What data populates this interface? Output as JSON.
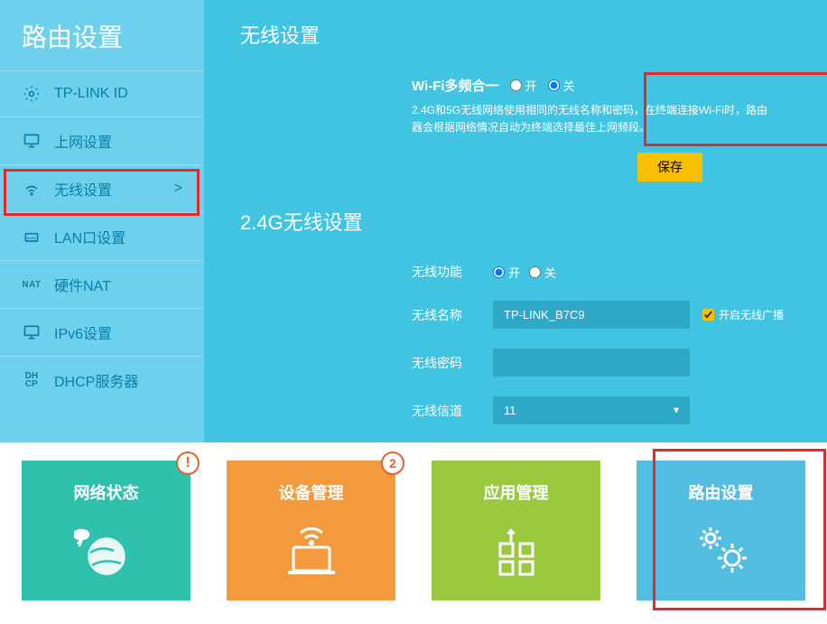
{
  "sidebar": {
    "title": "路由设置",
    "items": [
      {
        "label": "TP-LINK ID"
      },
      {
        "label": "上网设置"
      },
      {
        "label": "无线设置",
        "arrow": ">"
      },
      {
        "label": "LAN口设置"
      },
      {
        "label": "硬件NAT"
      },
      {
        "label": "IPv6设置"
      },
      {
        "label": "DHCP服务器"
      }
    ]
  },
  "content": {
    "wireless_title": "无线设置",
    "merge": {
      "label": "Wi-Fi多频合一",
      "on": "开",
      "off": "关",
      "desc": "2.4G和5G无线网络使用相同的无线名称和密码，在终端连接Wi-Fi时，路由器会根据网络情况自动为终端选择最佳上网频段。"
    },
    "save_label": "保存",
    "g24_title": "2.4G无线设置",
    "g24": {
      "func_label": "无线功能",
      "on": "开",
      "off": "关",
      "name_label": "无线名称",
      "name_value": "TP-LINK_B7C9",
      "broadcast_label": "开启无线广播",
      "pwd_label": "无线密码",
      "pwd_value": "",
      "channel_label": "无线信道",
      "channel_value": "11"
    }
  },
  "nav": {
    "cards": [
      {
        "title": "网络状态",
        "badge": "!"
      },
      {
        "title": "设备管理",
        "badge": "2"
      },
      {
        "title": "应用管理"
      },
      {
        "title": "路由设置"
      }
    ]
  }
}
